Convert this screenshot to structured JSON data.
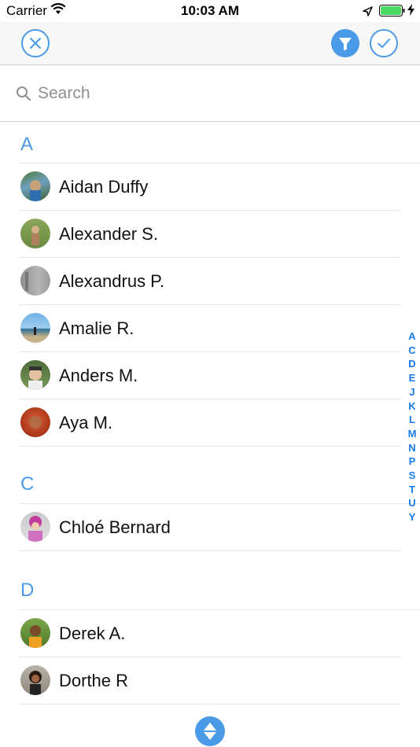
{
  "status_bar": {
    "carrier": "Carrier",
    "time": "10:03 AM"
  },
  "search": {
    "placeholder": "Search"
  },
  "sections": [
    {
      "letter": "A",
      "contacts": [
        {
          "name": "Aidan Duffy"
        },
        {
          "name": "Alexander S."
        },
        {
          "name": "Alexandrus P."
        },
        {
          "name": "Amalie R."
        },
        {
          "name": "Anders M."
        },
        {
          "name": "Aya M."
        }
      ]
    },
    {
      "letter": "C",
      "contacts": [
        {
          "name": "Chloé Bernard"
        }
      ]
    },
    {
      "letter": "D",
      "contacts": [
        {
          "name": "Derek A."
        },
        {
          "name": "Dorthe R"
        }
      ]
    }
  ],
  "index_letters": [
    "A",
    "C",
    "D",
    "E",
    "J",
    "K",
    "L",
    "M",
    "N",
    "P",
    "S",
    "T",
    "U",
    "Y"
  ],
  "colors": {
    "accent": "#4a9ae8",
    "index": "#1a7ae8",
    "battery": "#4cd964"
  },
  "icons": {
    "close": "close-icon",
    "filter": "filter-icon",
    "confirm": "checkmark-icon",
    "search": "search-icon",
    "sort": "sort-arrows-icon"
  }
}
